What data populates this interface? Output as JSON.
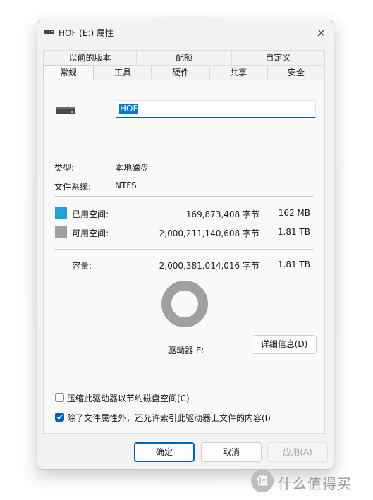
{
  "window": {
    "title": "HOF (E:) 属性"
  },
  "tabs_row1": [
    "以前的版本",
    "配额",
    "自定义"
  ],
  "tabs_row2": [
    "常规",
    "工具",
    "硬件",
    "共享",
    "安全"
  ],
  "general": {
    "drive_name": "HOF",
    "type_label": "类型:",
    "type_value": "本地磁盘",
    "fs_label": "文件系统:",
    "fs_value": "NTFS",
    "used_label": "已用空间:",
    "used_bytes": "169,873,408 字节",
    "used_size": "162 MB",
    "free_label": "可用空间:",
    "free_bytes": "2,000,211,140,608 字节",
    "free_size": "1.81 TB",
    "capacity_label": "容量:",
    "capacity_bytes": "2,000,381,014,016 字节",
    "capacity_size": "1.81 TB",
    "drive_caption": "驱动器 E:",
    "details_button": "详细信息(D)",
    "compress_label": "压缩此驱动器以节约磁盘空间(C)",
    "index_label": "除了文件属性外，还允许索引此驱动器上文件的内容(I)",
    "compress_checked": false,
    "index_checked": true,
    "used_fraction": 8.49e-05
  },
  "buttons": {
    "ok": "确定",
    "cancel": "取消",
    "apply": "应用(A)"
  },
  "colors": {
    "used": "#26a0da",
    "free": "#a0a0a0",
    "accent": "#005fb8"
  },
  "watermark": {
    "logo": "值",
    "text": "什么值得买"
  }
}
